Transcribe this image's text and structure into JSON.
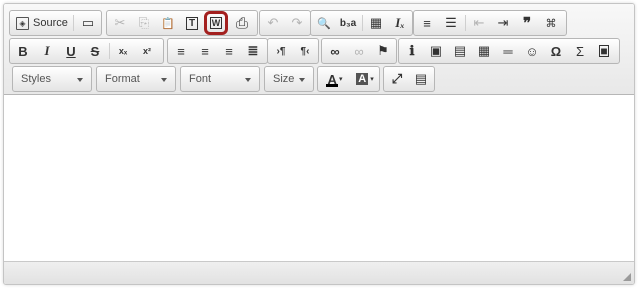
{
  "toolbar": {
    "source_label": "Source",
    "combos": {
      "styles": "Styles",
      "format": "Format",
      "font": "Font",
      "size": "Size"
    },
    "glyphs": {
      "undo": "↶",
      "redo": "↷",
      "find": "🔍",
      "replace": "b₃a",
      "select_all": "▦",
      "remove_format": "Iₓ",
      "numbered_list": "≡",
      "bulleted_list": "☰",
      "outdent": "⇤",
      "indent": "⇥",
      "blockquote": "❞",
      "div": "⌘",
      "bold": "B",
      "italic": "I",
      "underline": "U",
      "strike": "S",
      "subscript": "xₓ",
      "superscript": "x²",
      "align_left": "≡",
      "align_center": "≡",
      "align_right": "≡",
      "justify": "≣",
      "ltr": "›¶",
      "rtl": "¶‹",
      "link": "∞",
      "unlink": "∞",
      "anchor": "⚑",
      "info": "ℹ",
      "image": "▣",
      "flash": "▤",
      "table": "▦",
      "hr": "═",
      "smiley": "☺",
      "special_char": "Ω",
      "sum": "Σ",
      "iframe": "■",
      "text_color": "A",
      "bg_color": "A",
      "maximize": "⤢",
      "show_blocks": "▤",
      "cut": "✂",
      "copy": "⎘",
      "paste": "📋",
      "paste_text": "T",
      "paste_word": "W",
      "print": "⎙",
      "template": "▭"
    }
  },
  "colors": {
    "highlight_border": "#a3201f",
    "text_color_bar": "#000000",
    "bg_color_bar": "#000000"
  }
}
